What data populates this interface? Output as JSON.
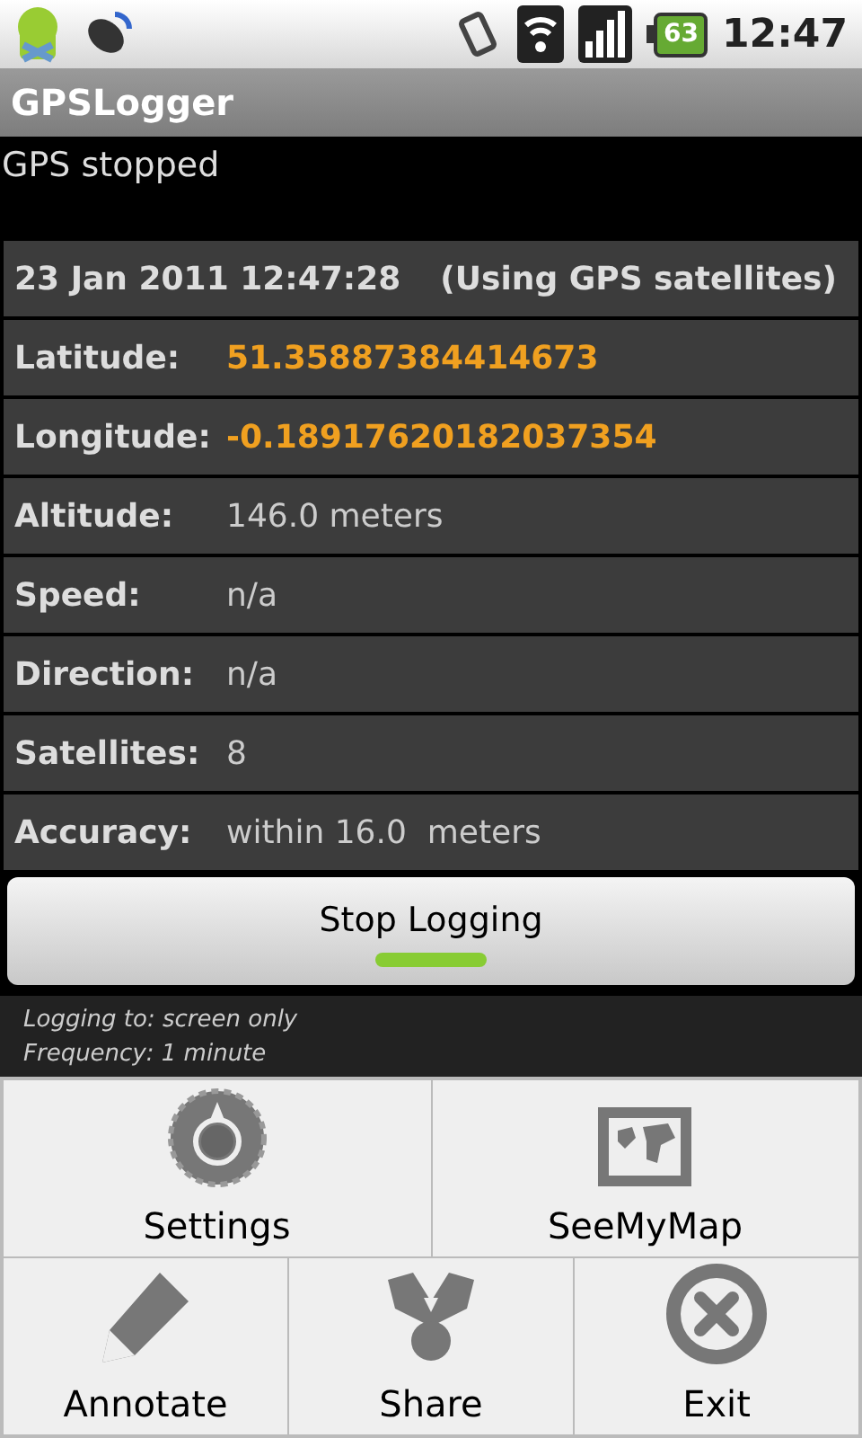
{
  "status_bar": {
    "battery": "63",
    "time": "12:47"
  },
  "title": "GPSLogger",
  "status_text": "GPS stopped",
  "header": {
    "datetime": "23 Jan 2011 12:47:28",
    "source": "(Using GPS satellites)"
  },
  "fields": [
    {
      "label": "Latitude:",
      "value": "51.35887384414673",
      "highlight": true
    },
    {
      "label": "Longitude:",
      "value": "-0.18917620182037354",
      "highlight": true
    },
    {
      "label": "Altitude:",
      "value": "146.0 meters",
      "highlight": false
    },
    {
      "label": "Speed:",
      "value": "n/a",
      "highlight": false
    },
    {
      "label": "Direction:",
      "value": "n/a",
      "highlight": false
    },
    {
      "label": "Satellites:",
      "value": "8",
      "highlight": false
    },
    {
      "label": "Accuracy:",
      "value": "within 16.0  meters",
      "highlight": false
    }
  ],
  "button": {
    "label": "Stop Logging",
    "on": true
  },
  "info": [
    "Logging to: screen only",
    "Frequency: 1 minute"
  ],
  "menu": [
    [
      {
        "label": "Settings",
        "kind": "gear"
      },
      {
        "label": "SeeMyMap",
        "kind": "map"
      }
    ],
    [
      {
        "label": "Annotate",
        "kind": "pencil"
      },
      {
        "label": "Share",
        "kind": "share"
      },
      {
        "label": "Exit",
        "kind": "close"
      }
    ]
  ]
}
